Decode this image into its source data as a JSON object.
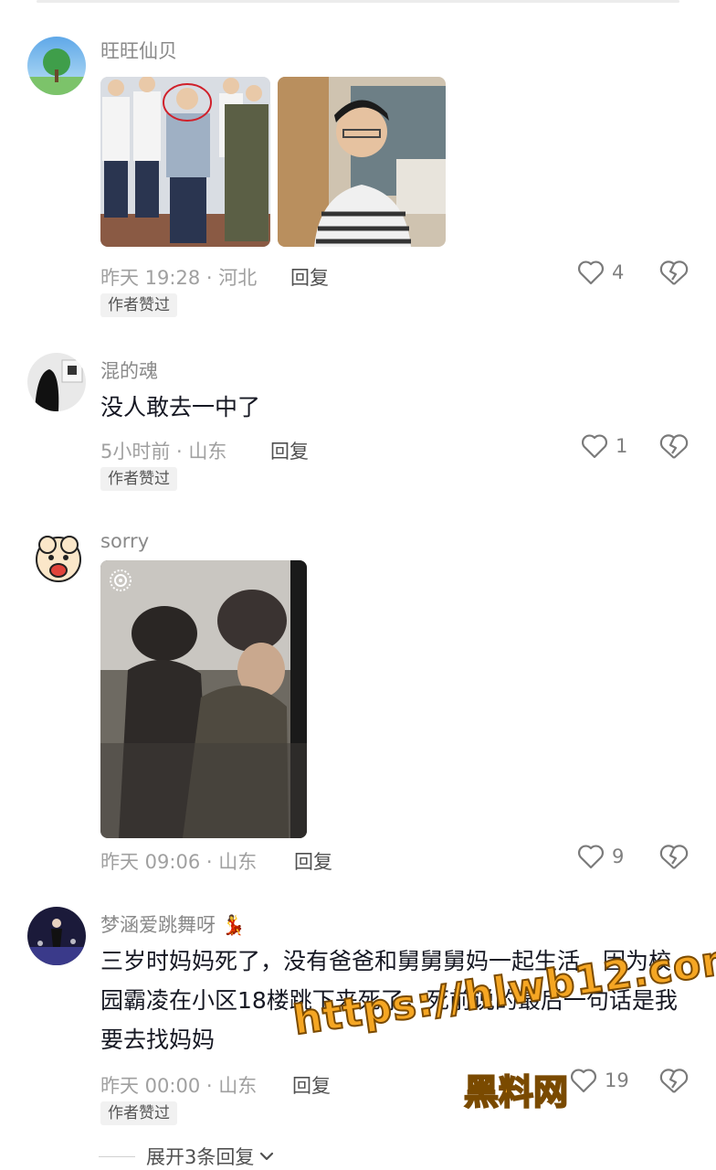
{
  "comments": [
    {
      "username": "旺旺仙贝",
      "text": "",
      "meta": "昨天 19:28 · 河北",
      "reply": "回复",
      "likes": "4",
      "badge": "作者赞过",
      "images": [
        "group-photo",
        "selfie-photo"
      ]
    },
    {
      "username": "混的魂",
      "text": "没人敢去一中了",
      "meta": "5小时前 · 山东",
      "reply": "回复",
      "likes": "1",
      "badge": "作者赞过"
    },
    {
      "username": "sorry",
      "text": "",
      "meta": "昨天 09:06 · 山东",
      "reply": "回复",
      "likes": "9",
      "images": [
        "live-photo"
      ]
    },
    {
      "username": "梦涵爱跳舞呀",
      "text": "三岁时妈妈死了，没有爸爸和舅舅舅妈一起生活，因为校园霸凌在小区18楼跳下来死了，死前说的最后一句话是我要去找妈妈",
      "meta": "昨天 00:00 · 山东",
      "reply": "回复",
      "likes": "19",
      "badge": "作者赞过"
    }
  ],
  "expand_replies": "展开3条回复",
  "watermark": {
    "url": "https://hlwb12.com",
    "label": "黑料网"
  },
  "colors": {
    "watermark": "#f5a623",
    "text": "#161823",
    "muted": "#a0a0a0"
  }
}
